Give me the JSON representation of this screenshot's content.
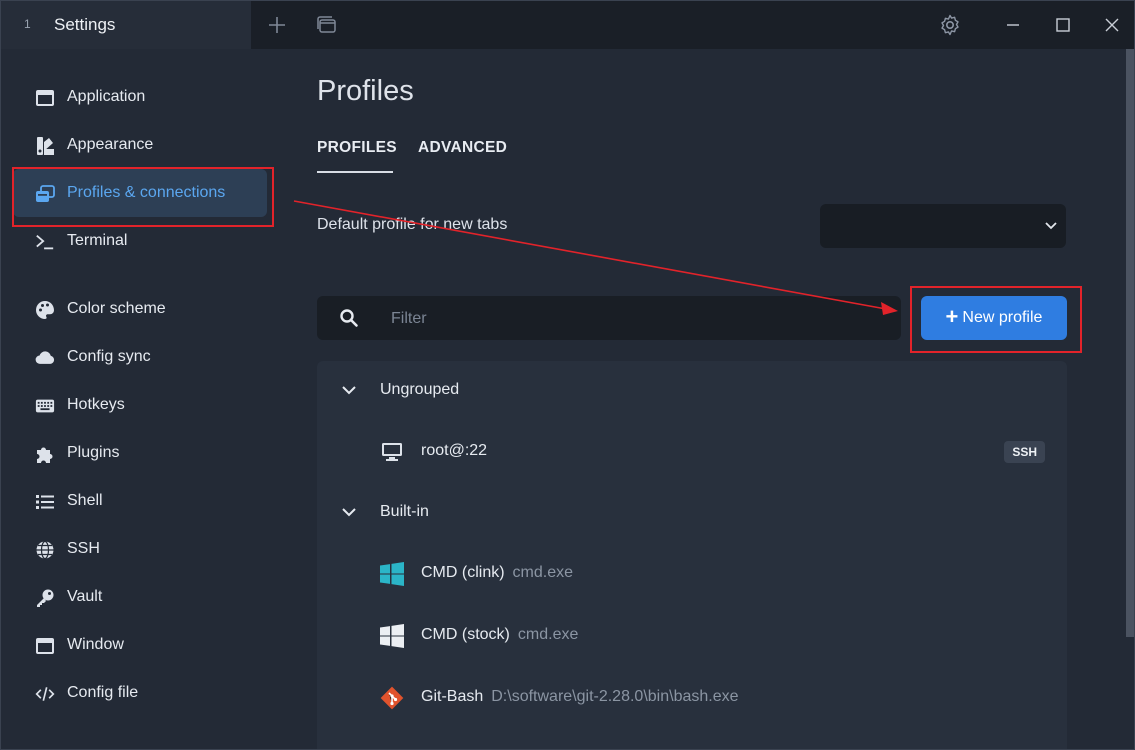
{
  "window": {
    "tab_number": "1",
    "tab_title": "Settings",
    "add_tab_icon": "plus-icon",
    "tabs_overview_icon": "window-stack-icon",
    "settings_icon": "gear-icon",
    "minimize_icon": "minimize-icon",
    "maximize_icon": "maximize-icon",
    "close_icon": "close-icon"
  },
  "sidebar": {
    "items": [
      {
        "label": "Application",
        "icon": "window-icon"
      },
      {
        "label": "Appearance",
        "icon": "palette-swatch-icon"
      },
      {
        "label": "Profiles & connections",
        "icon": "profiles-stack-icon",
        "active": true
      },
      {
        "label": "Terminal",
        "icon": "terminal-prompt-icon"
      },
      {
        "label": "Color scheme",
        "icon": "palette-icon"
      },
      {
        "label": "Config sync",
        "icon": "cloud-icon"
      },
      {
        "label": "Hotkeys",
        "icon": "keyboard-icon"
      },
      {
        "label": "Plugins",
        "icon": "puzzle-icon"
      },
      {
        "label": "Shell",
        "icon": "list-icon"
      },
      {
        "label": "SSH",
        "icon": "globe-icon"
      },
      {
        "label": "Vault",
        "icon": "key-icon"
      },
      {
        "label": "Window",
        "icon": "window-icon"
      },
      {
        "label": "Config file",
        "icon": "code-icon"
      }
    ]
  },
  "main": {
    "title": "Profiles",
    "tabs": [
      {
        "label": "PROFILES",
        "active": true
      },
      {
        "label": "ADVANCED",
        "active": false
      }
    ],
    "default_profile": {
      "label": "Default profile for new tabs",
      "value": ""
    },
    "filter": {
      "placeholder": "Filter",
      "value": ""
    },
    "new_profile_label": "New profile",
    "groups": [
      {
        "label": "Ungrouped",
        "profiles": [
          {
            "name": "root@:22",
            "desc": "",
            "badge": "SSH",
            "icon": "monitor-icon"
          }
        ]
      },
      {
        "label": "Built-in",
        "profiles": [
          {
            "name": "CMD (clink)",
            "desc": "cmd.exe",
            "icon": "windows-logo-icon"
          },
          {
            "name": "CMD (stock)",
            "desc": "cmd.exe",
            "icon": "windows-logo-icon"
          },
          {
            "name": "Git-Bash",
            "desc": "D:\\software\\git-2.28.0\\bin\\bash.exe",
            "icon": "git-icon"
          }
        ]
      }
    ]
  },
  "colors": {
    "background": "#232a36",
    "accent": "#2f7de1",
    "active_text": "#5ba7f0",
    "annotation": "#e2232a",
    "clink_icon": "#2bb5c8",
    "git_icon": "#e0532d"
  }
}
